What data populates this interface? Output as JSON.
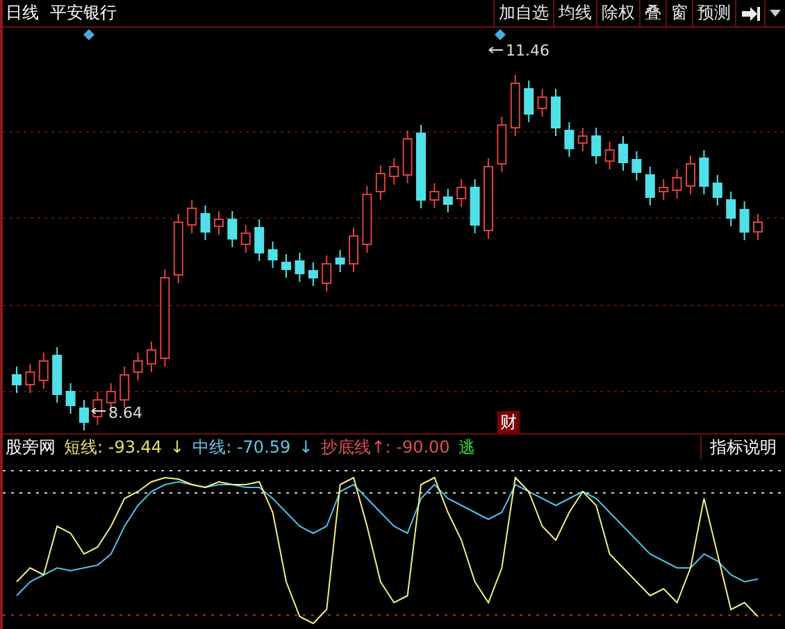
{
  "header": {
    "period": "日线",
    "stock": "平安银行"
  },
  "toolbar": [
    {
      "label": "加自选"
    },
    {
      "label": "均线"
    },
    {
      "label": "除权"
    },
    {
      "label": "叠"
    },
    {
      "label": "窗"
    },
    {
      "label": "预测"
    }
  ],
  "price_labels": {
    "high": "11.46",
    "low": "8.64"
  },
  "event_badge": "财",
  "indicator": {
    "name": "股旁网",
    "series": [
      {
        "text": "短线: -93.44",
        "arrow": "↓",
        "color": "#e8e070"
      },
      {
        "text": "中线: -70.59",
        "arrow": "↓",
        "color": "#60c8e8"
      },
      {
        "text": "抄底线↑: -90.00",
        "color": "#e05050"
      }
    ],
    "signal": "逃",
    "help": "指标说明"
  }
}
